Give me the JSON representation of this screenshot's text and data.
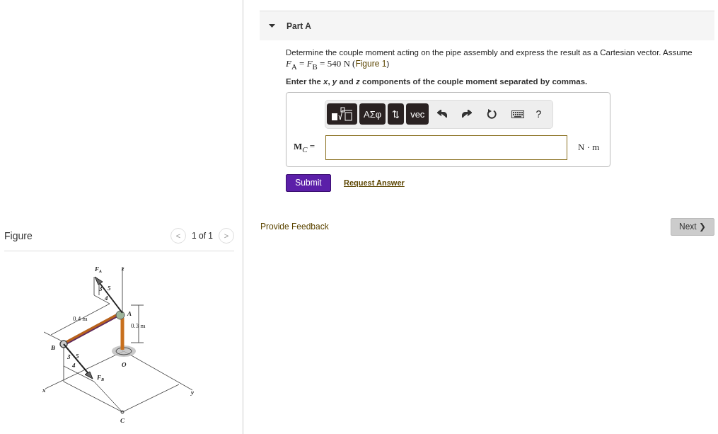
{
  "figure_panel": {
    "title": "Figure",
    "pager": {
      "prev": "<",
      "count": "1 of 1",
      "next": ">"
    },
    "labels": [
      {
        "text": "F",
        "sub": "A"
      },
      {
        "text": "z"
      },
      {
        "text": "3"
      },
      {
        "text": "5"
      },
      {
        "text": "4"
      },
      {
        "text": "A"
      },
      {
        "text": "0.4 m"
      },
      {
        "text": "0.3 m"
      },
      {
        "text": "B"
      },
      {
        "text": "3"
      },
      {
        "text": "5"
      },
      {
        "text": "4"
      },
      {
        "text": "O"
      },
      {
        "text": "F",
        "sub": "B"
      },
      {
        "text": "x"
      },
      {
        "text": "y"
      },
      {
        "text": "C"
      }
    ]
  },
  "part": {
    "title": "Part A",
    "expanded": true,
    "prompt": "Determine the couple moment acting on the pipe assembly and express the result as a Cartesian vector. Assume",
    "equation": "*F*$_{A}$ = *F*$_{B}$ = 540 N (",
    "figure_link": "Figure 1",
    "equation_end": ")",
    "instruction": "Enter the *x*, *y* and *z* components of the couple moment separated by commas.",
    "toolbar": [
      {
        "kind": "template"
      },
      {
        "kind": "text",
        "label": "ΑΣφ"
      },
      {
        "kind": "text",
        "label": "⇅"
      },
      {
        "kind": "text",
        "label": "vec"
      },
      {
        "kind": "undo"
      },
      {
        "kind": "redo"
      },
      {
        "kind": "reset"
      },
      {
        "kind": "keyboard"
      },
      {
        "kind": "help",
        "label": "?"
      }
    ],
    "answer_label": "**M**$_{C}$ =",
    "units": "N · m",
    "submit": "Submit",
    "request_answer": "Request Answer"
  },
  "feedback_link": "Provide Feedback",
  "next_button": "Next ❯"
}
